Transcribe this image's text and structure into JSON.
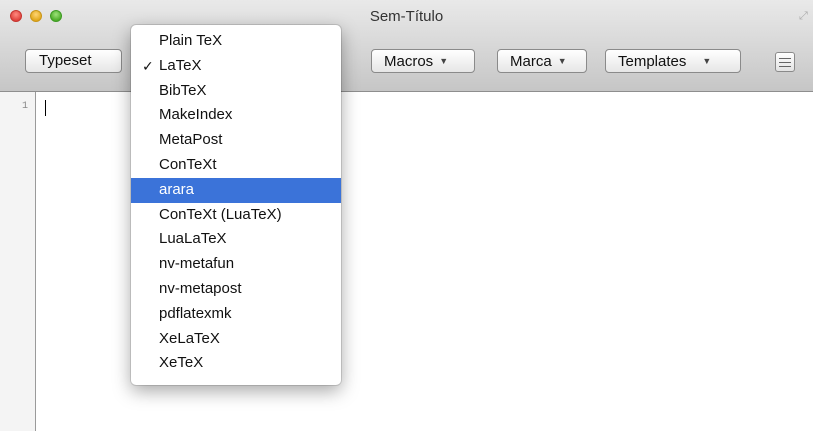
{
  "window": {
    "title": "Sem-Título"
  },
  "toolbar": {
    "typeset_label": "Typeset",
    "macros_label": "Macros",
    "marca_label": "Marca",
    "templates_label": "Templates"
  },
  "editor": {
    "line_number": "1"
  },
  "menu": {
    "items": [
      {
        "label": "Plain TeX",
        "checked": false,
        "highlighted": false
      },
      {
        "label": "LaTeX",
        "checked": true,
        "highlighted": false
      },
      {
        "label": "BibTeX",
        "checked": false,
        "highlighted": false
      },
      {
        "label": "MakeIndex",
        "checked": false,
        "highlighted": false
      },
      {
        "label": "MetaPost",
        "checked": false,
        "highlighted": false
      },
      {
        "label": "ConTeXt",
        "checked": false,
        "highlighted": false
      },
      {
        "label": "arara",
        "checked": false,
        "highlighted": true
      },
      {
        "label": "ConTeXt (LuaTeX)",
        "checked": false,
        "highlighted": false
      },
      {
        "label": "LuaLaTeX",
        "checked": false,
        "highlighted": false
      },
      {
        "label": "nv-metafun",
        "checked": false,
        "highlighted": false
      },
      {
        "label": "nv-metapost",
        "checked": false,
        "highlighted": false
      },
      {
        "label": "pdflatexmk",
        "checked": false,
        "highlighted": false
      },
      {
        "label": "XeLaTeX",
        "checked": false,
        "highlighted": false
      },
      {
        "label": "XeTeX",
        "checked": false,
        "highlighted": false
      }
    ],
    "check_glyph": "✓"
  },
  "colors": {
    "highlight": "#3b73d9"
  }
}
